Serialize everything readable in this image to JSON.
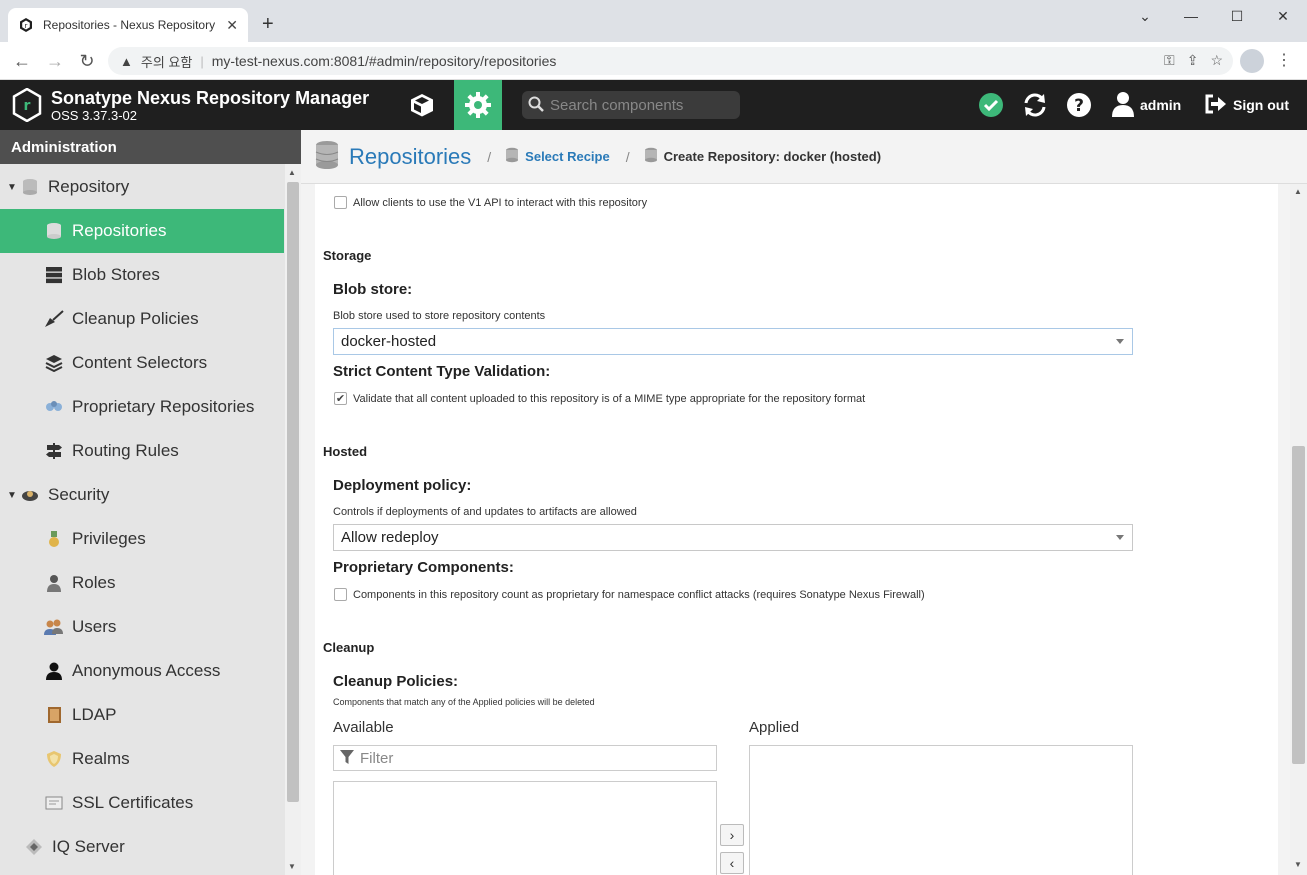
{
  "browser": {
    "tab_title": "Repositories - Nexus Repository Manager",
    "tab_close": "✕",
    "new_tab": "+",
    "security_warning": "주의 요함",
    "url": "my-test-nexus.com:8081/#admin/repository/repositories"
  },
  "header": {
    "app_title": "Sonatype Nexus Repository Manager",
    "version": "OSS 3.37.3-02",
    "search_placeholder": "Search components",
    "user": "admin",
    "sign_out": "Sign out"
  },
  "sidebar": {
    "title": "Administration",
    "items": [
      {
        "label": "Repository",
        "icon": "database-icon",
        "group": true
      },
      {
        "label": "Repositories",
        "icon": "database-icon",
        "active": true
      },
      {
        "label": "Blob Stores",
        "icon": "server-icon"
      },
      {
        "label": "Cleanup Policies",
        "icon": "broom-icon"
      },
      {
        "label": "Content Selectors",
        "icon": "layers-icon"
      },
      {
        "label": "Proprietary Repositories",
        "icon": "proprietary-icon"
      },
      {
        "label": "Routing Rules",
        "icon": "signpost-icon"
      },
      {
        "label": "Security",
        "icon": "security-icon",
        "group": true
      },
      {
        "label": "Privileges",
        "icon": "medal-icon"
      },
      {
        "label": "Roles",
        "icon": "role-icon"
      },
      {
        "label": "Users",
        "icon": "users-icon"
      },
      {
        "label": "Anonymous Access",
        "icon": "person-icon"
      },
      {
        "label": "LDAP",
        "icon": "book-icon"
      },
      {
        "label": "Realms",
        "icon": "shield-icon"
      },
      {
        "label": "SSL Certificates",
        "icon": "certificate-icon"
      },
      {
        "label": "IQ Server",
        "icon": "iq-icon",
        "group": true
      }
    ]
  },
  "breadcrumb": {
    "title": "Repositories",
    "step1": "Select Recipe",
    "step2": "Create Repository: docker (hosted)",
    "separator": "/"
  },
  "form": {
    "v1_api_label": "Allow clients to use the V1 API to interact with this repository",
    "v1_api_checked": false,
    "storage_section": "Storage",
    "blob_store_label": "Blob store:",
    "blob_store_help": "Blob store used to store repository contents",
    "blob_store_value": "docker-hosted",
    "strict_label": "Strict Content Type Validation:",
    "strict_help": "Validate that all content uploaded to this repository is of a MIME type appropriate for the repository format",
    "strict_checked": true,
    "hosted_section": "Hosted",
    "deploy_label": "Deployment policy:",
    "deploy_help": "Controls if deployments of and updates to artifacts are allowed",
    "deploy_value": "Allow redeploy",
    "proprietary_label": "Proprietary Components:",
    "proprietary_help": "Components in this repository count as proprietary for namespace conflict attacks (requires Sonatype Nexus Firewall)",
    "proprietary_checked": false,
    "cleanup_section": "Cleanup",
    "cleanup_label": "Cleanup Policies:",
    "cleanup_help": "Components that match any of the Applied policies will be deleted",
    "available_label": "Available",
    "applied_label": "Applied",
    "filter_placeholder": "Filter"
  },
  "colors": {
    "accent": "#3db879",
    "header_bg": "#1f1f1f",
    "link": "#2a7ab8"
  }
}
